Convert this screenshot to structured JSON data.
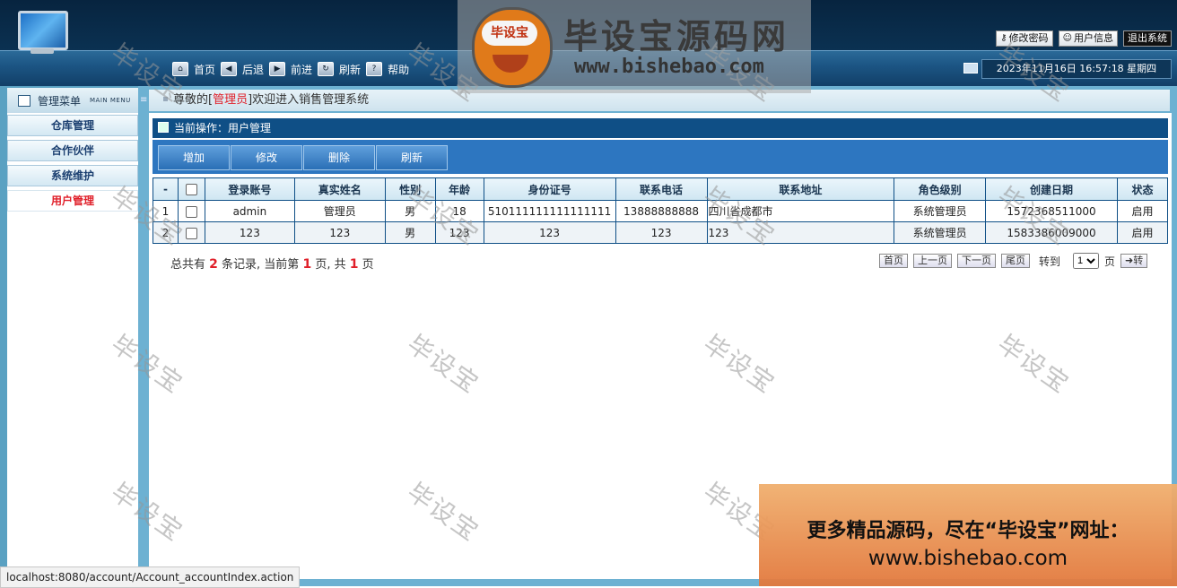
{
  "header": {
    "nav": [
      {
        "label": "首页",
        "icon": "home-icon"
      },
      {
        "label": "后退",
        "icon": "back-arrow-icon"
      },
      {
        "label": "前进",
        "icon": "forward-arrow-icon"
      },
      {
        "label": "刷新",
        "icon": "refresh-icon"
      },
      {
        "label": "帮助",
        "icon": "help-icon"
      }
    ],
    "links": {
      "change_password": "修改密码",
      "user_info": "用户信息",
      "logout": "退出系统"
    },
    "datetime": "2023年11月16日 16:57:18 星期四"
  },
  "sidebar": {
    "title": "管理菜单",
    "subtitle": "MAIN MENU",
    "items": [
      {
        "label": "仓库管理"
      },
      {
        "label": "合作伙伴"
      },
      {
        "label": "系统维护"
      },
      {
        "label": "用户管理"
      }
    ]
  },
  "welcome": {
    "prefix": "尊敬的[",
    "role": "管理员",
    "suffix": "]欢迎进入销售管理系统"
  },
  "main": {
    "current_op": "当前操作：用户管理",
    "toolbar": {
      "add": "增加",
      "edit": "修改",
      "delete": "删除",
      "refresh": "刷新"
    },
    "columns": [
      "-",
      "",
      "登录账号",
      "真实姓名",
      "性别",
      "年龄",
      "身份证号",
      "联系电话",
      "联系地址",
      "角色级别",
      "创建日期",
      "状态"
    ],
    "rows": [
      {
        "idx": "1",
        "account": "admin",
        "name": "管理员",
        "gender": "男",
        "age": "18",
        "id_no": "510111111111111111",
        "phone": "13888888888",
        "address": "四川省成都市",
        "role": "系统管理员",
        "created": "1572368511000",
        "status": "启用"
      },
      {
        "idx": "2",
        "account": "123",
        "name": "123",
        "gender": "男",
        "age": "123",
        "id_no": "123",
        "phone": "123",
        "address": "123",
        "role": "系统管理员",
        "created": "1583386009000",
        "status": "启用"
      }
    ],
    "pager": {
      "t1": "总共有",
      "total": "2",
      "t2": "条记录, 当前第",
      "page": "1",
      "t3": "页, 共",
      "pages": "1",
      "t4": "页",
      "first": "首页",
      "prev": "上一页",
      "next": "下一页",
      "last": "尾页",
      "goto": "转到",
      "page_select": "1",
      "page_unit": "页",
      "go": "转"
    }
  },
  "overlay": {
    "watermark": "毕设宝",
    "logo_badge": "毕设宝",
    "logo_title": "毕设宝源码网",
    "logo_url": "www.bishebao.com",
    "promo_line1": "更多精品源码，尽在“毕设宝”网址：",
    "promo_line2": "www.bishebao.com"
  },
  "statusbar": "localhost:8080/account/Account_accountIndex.action"
}
